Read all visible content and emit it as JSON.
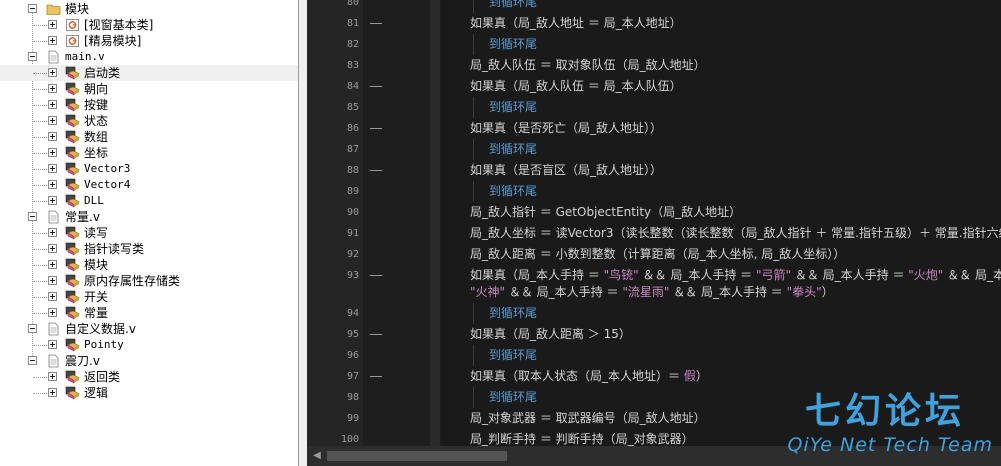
{
  "tree": {
    "items": [
      {
        "label": "模块",
        "level": 1,
        "icon": "folder-icon",
        "expander": "minus"
      },
      {
        "label": "[视窗基本类]",
        "level": 2,
        "icon": "library-icon",
        "expander": "plus"
      },
      {
        "label": "[精易模块]",
        "level": 2,
        "icon": "library-icon",
        "expander": "plus"
      },
      {
        "label": "main.v",
        "level": 1,
        "icon": "file-icon",
        "expander": "minus",
        "mono": true
      },
      {
        "label": "启动类",
        "level": 2,
        "icon": "class-icon",
        "expander": "plus",
        "selected": true
      },
      {
        "label": "朝向",
        "level": 2,
        "icon": "class-icon",
        "expander": "plus"
      },
      {
        "label": "按键",
        "level": 2,
        "icon": "class-icon",
        "expander": "plus"
      },
      {
        "label": "状态",
        "level": 2,
        "icon": "class-icon",
        "expander": "plus"
      },
      {
        "label": "数组",
        "level": 2,
        "icon": "class-icon",
        "expander": "plus"
      },
      {
        "label": "坐标",
        "level": 2,
        "icon": "class-icon",
        "expander": "plus"
      },
      {
        "label": "Vector3",
        "level": 2,
        "icon": "class-icon",
        "expander": "plus",
        "mono": true
      },
      {
        "label": "Vector4",
        "level": 2,
        "icon": "class-icon",
        "expander": "plus",
        "mono": true
      },
      {
        "label": "DLL",
        "level": 2,
        "icon": "class-icon",
        "expander": "plus",
        "mono": true
      },
      {
        "label": "常量.v",
        "level": 1,
        "icon": "file-icon",
        "expander": "minus"
      },
      {
        "label": "读写",
        "level": 2,
        "icon": "class-icon",
        "expander": "plus"
      },
      {
        "label": "指针读写类",
        "level": 2,
        "icon": "class-icon",
        "expander": "plus"
      },
      {
        "label": "模块",
        "level": 2,
        "icon": "class-icon",
        "expander": "plus"
      },
      {
        "label": "原内存属性存储类",
        "level": 2,
        "icon": "class-icon",
        "expander": "plus"
      },
      {
        "label": "开关",
        "level": 2,
        "icon": "class-icon",
        "expander": "plus"
      },
      {
        "label": "常量",
        "level": 2,
        "icon": "class-icon",
        "expander": "plus"
      },
      {
        "label": "自定义数据.v",
        "level": 1,
        "icon": "file-icon",
        "expander": "minus"
      },
      {
        "label": "Pointy",
        "level": 2,
        "icon": "class-icon",
        "expander": "plus",
        "mono": true
      },
      {
        "label": "震刀.v",
        "level": 1,
        "icon": "file-icon",
        "expander": "minus"
      },
      {
        "label": "返回类",
        "level": 2,
        "icon": "class-icon",
        "expander": "plus"
      },
      {
        "label": "逻辑",
        "level": 2,
        "icon": "class-icon",
        "expander": "plus"
      }
    ]
  },
  "editor": {
    "lines": [
      {
        "n": "80",
        "fold": false,
        "indent": true,
        "segments": [
          {
            "t": "到循环尾",
            "c": "kw"
          }
        ]
      },
      {
        "n": "81",
        "fold": true,
        "indent": false,
        "segments": [
          {
            "t": "如果真（局_敌人地址 ",
            "c": "n"
          },
          {
            "t": "＝",
            "c": "op"
          },
          {
            "t": " 局_本人地址）",
            "c": "n"
          }
        ]
      },
      {
        "n": "82",
        "fold": false,
        "indent": true,
        "segments": [
          {
            "t": "到循环尾",
            "c": "kw"
          }
        ]
      },
      {
        "n": "83",
        "fold": false,
        "indent": false,
        "segments": [
          {
            "t": "局_敌人队伍 ＝ 取对象队伍（局_敌人地址）",
            "c": "n"
          }
        ]
      },
      {
        "n": "84",
        "fold": true,
        "indent": false,
        "segments": [
          {
            "t": "如果真（局_敌人队伍 ",
            "c": "n"
          },
          {
            "t": "＝",
            "c": "op"
          },
          {
            "t": " 局_本人队伍）",
            "c": "n"
          }
        ]
      },
      {
        "n": "85",
        "fold": false,
        "indent": true,
        "segments": [
          {
            "t": "到循环尾",
            "c": "kw"
          }
        ]
      },
      {
        "n": "86",
        "fold": true,
        "indent": false,
        "segments": [
          {
            "t": "如果真（是否死亡（局_敌人地址））",
            "c": "n"
          }
        ]
      },
      {
        "n": "87",
        "fold": false,
        "indent": true,
        "segments": [
          {
            "t": "到循环尾",
            "c": "kw"
          }
        ]
      },
      {
        "n": "88",
        "fold": true,
        "indent": false,
        "segments": [
          {
            "t": "如果真（是否盲区（局_敌人地址））",
            "c": "n"
          }
        ]
      },
      {
        "n": "89",
        "fold": false,
        "indent": true,
        "segments": [
          {
            "t": "到循环尾",
            "c": "kw"
          }
        ]
      },
      {
        "n": "90",
        "fold": false,
        "indent": false,
        "segments": [
          {
            "t": "局_敌人指针 ＝ GetObjectEntity（局_敌人地址）",
            "c": "n"
          }
        ]
      },
      {
        "n": "91",
        "fold": false,
        "indent": false,
        "segments": [
          {
            "t": "局_敌人坐标 ＝ 读Vector3（读长整数（读长整数（局_敌人指针 ＋ 常量.指针五级）＋ 常量.指针六级",
            "c": "n"
          }
        ]
      },
      {
        "n": "92",
        "fold": false,
        "indent": false,
        "segments": [
          {
            "t": "局_敌人距离 ＝ 小数到整数（计算距离（局_本人坐标, 局_敌人坐标））",
            "c": "n"
          }
        ]
      },
      {
        "n": "93",
        "fold": true,
        "indent": false,
        "tall": true,
        "segments": [
          {
            "t": "如果真（局_本人手持 ＝ ",
            "c": "n"
          },
          {
            "t": "\"鸟铳\"",
            "c": "s"
          },
          {
            "t": " ＆＆ 局_本人手持 ＝ ",
            "c": "n"
          },
          {
            "t": "\"弓箭\"",
            "c": "s"
          },
          {
            "t": " ＆＆ 局_本人手持 ＝ ",
            "c": "n"
          },
          {
            "t": "\"火炮\"",
            "c": "s"
          },
          {
            "t": " ＆＆ 局_本人",
            "c": "n"
          }
        ],
        "segments2": [
          {
            "t": "\"火神\"",
            "c": "s"
          },
          {
            "t": " ＆＆ 局_本人手持 ＝ ",
            "c": "n"
          },
          {
            "t": "\"流星雨\"",
            "c": "s"
          },
          {
            "t": " ＆＆ 局_本人手持 ＝ ",
            "c": "n"
          },
          {
            "t": "\"拳头\"",
            "c": "s"
          },
          {
            "t": "）",
            "c": "n"
          }
        ]
      },
      {
        "n": "94",
        "fold": false,
        "indent": true,
        "segments": [
          {
            "t": "到循环尾",
            "c": "kw"
          }
        ]
      },
      {
        "n": "95",
        "fold": true,
        "indent": false,
        "segments": [
          {
            "t": "如果真（局_敌人距离 ",
            "c": "n"
          },
          {
            "t": "＞",
            "c": "op"
          },
          {
            "t": " 15）",
            "c": "n"
          }
        ]
      },
      {
        "n": "96",
        "fold": false,
        "indent": true,
        "segments": [
          {
            "t": "到循环尾",
            "c": "kw"
          }
        ]
      },
      {
        "n": "97",
        "fold": true,
        "indent": false,
        "segments": [
          {
            "t": "如果真（取本人状态（局_本人地址）＝ ",
            "c": "n"
          },
          {
            "t": "假",
            "c": "b"
          },
          {
            "t": "）",
            "c": "n"
          }
        ]
      },
      {
        "n": "98",
        "fold": false,
        "indent": true,
        "segments": [
          {
            "t": "到循环尾",
            "c": "kw"
          }
        ]
      },
      {
        "n": "99",
        "fold": false,
        "indent": false,
        "segments": [
          {
            "t": "局_对象武器 ＝ 取武器编号（局_敌人地址）",
            "c": "n"
          }
        ]
      },
      {
        "n": "100",
        "fold": false,
        "indent": false,
        "segments": [
          {
            "t": "局_判断手持 ＝ 判断手持（局_对象武器）",
            "c": "n"
          }
        ]
      }
    ]
  },
  "watermark": {
    "title": "七幻论坛",
    "subtitle": "QiYe Net Tech Team"
  },
  "colors": {
    "keyword": "#569cd6",
    "string": "#c586c0",
    "text": "#d4d4d4",
    "watermark": "#3ea2e0"
  }
}
